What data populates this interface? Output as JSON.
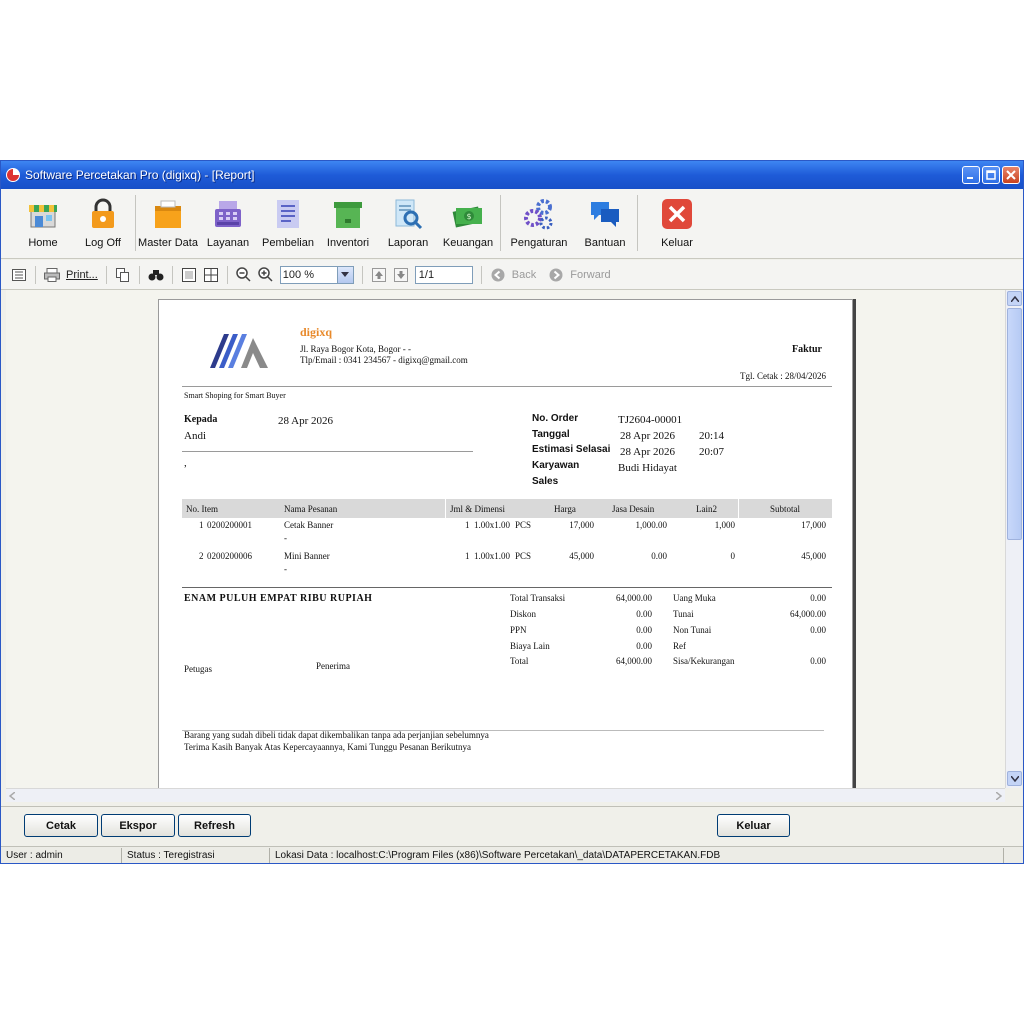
{
  "window": {
    "title": "Software Percetakan Pro (digixq) - [Report]"
  },
  "toolbar": {
    "items": [
      {
        "label": "Home"
      },
      {
        "label": "Log Off"
      },
      {
        "label": "Master Data"
      },
      {
        "label": "Layanan"
      },
      {
        "label": "Pembelian"
      },
      {
        "label": "Inventori"
      },
      {
        "label": "Laporan"
      },
      {
        "label": "Keuangan"
      },
      {
        "label": "Pengaturan"
      },
      {
        "label": "Bantuan"
      },
      {
        "label": "Keluar"
      }
    ]
  },
  "viewer": {
    "print_label": "Print...",
    "zoom": "100 %",
    "page": "1/1",
    "back_label": "Back",
    "forward_label": "Forward"
  },
  "invoice": {
    "company": "digixq",
    "address": "Jl. Raya Bogor Kota, Bogor - -",
    "contact": "Tlp/Email : 0341 234567 - digixq@gmail.com",
    "doc_title": "Faktur",
    "print_date": "Tgl. Cetak : 28/04/2026",
    "tagline": "Smart Shoping for Smart Buyer",
    "to_label": "Kepada",
    "to_date": "28 Apr 2026",
    "customer": "Andi",
    "customer_extra": ",",
    "order_no_label": "No. Order",
    "order_no": "TJ2604-00001",
    "date_label": "Tanggal",
    "date": "28 Apr 2026",
    "time": "20:14",
    "est_label": "Estimasi Selasai",
    "est_date": "28 Apr 2026",
    "est_time": "20:07",
    "employee_label": "Karyawan",
    "employee": "Budi Hidayat",
    "sales_label": "Sales",
    "columns": {
      "no_item": "No.  Item",
      "name": "Nama Pesanan",
      "qty": "Jml & Dimensi",
      "price": "Harga",
      "design": "Jasa Desain",
      "other": "Lain2",
      "subtotal": "Subtotal"
    },
    "rows": [
      {
        "no": "1",
        "item": "0200200001",
        "name": "Cetak Banner",
        "note": "-",
        "qty": "1",
        "dim": "1.00x1.00",
        "unit": "PCS",
        "price": "17,000",
        "design": "1,000.00",
        "other": "1,000",
        "subtotal": "17,000"
      },
      {
        "no": "2",
        "item": "0200200006",
        "name": "Mini Banner",
        "note": "-",
        "qty": "1",
        "dim": "1.00x1.00",
        "unit": "PCS",
        "price": "45,000",
        "design": "0.00",
        "other": "0",
        "subtotal": "45,000"
      }
    ],
    "amount_words": "ENAM PULUH EMPAT RIBU RUPIAH",
    "summary_left": [
      {
        "label": "Total Transaksi",
        "value": "64,000.00"
      },
      {
        "label": "Diskon",
        "value": "0.00"
      },
      {
        "label": "PPN",
        "value": "0.00"
      },
      {
        "label": "Biaya Lain",
        "value": "0.00"
      },
      {
        "label": "Total",
        "value": "64,000.00"
      }
    ],
    "summary_right": [
      {
        "label": "Uang Muka",
        "value": "0.00"
      },
      {
        "label": "Tunai",
        "value": "64,000.00"
      },
      {
        "label": "Non Tunai",
        "value": "0.00"
      },
      {
        "label": "Ref",
        "value": ""
      },
      {
        "label": "Sisa/Kekurangan",
        "value": "0.00"
      }
    ],
    "officer_label": "Petugas",
    "receiver_label": "Penerima",
    "note1": "Barang yang sudah dibeli tidak dapat dikembalikan tanpa ada perjanjian sebelumnya",
    "note2": "Terima Kasih Banyak Atas Kepercayaannya, Kami Tunggu Pesanan Berikutnya"
  },
  "buttons": {
    "print": "Cetak",
    "export": "Ekspor",
    "refresh": "Refresh",
    "exit": "Keluar"
  },
  "status": {
    "user": "User : admin",
    "state": "Status : Teregistrasi",
    "location": "Lokasi Data : localhost:C:\\Program Files (x86)\\Software Percetakan\\_data\\DATAPERCETAKAN.FDB"
  },
  "colors": {
    "titlebar": "#1e5bd8",
    "company": "#e8892a",
    "logo": "#2d3b8c",
    "close": "#e0483a"
  }
}
